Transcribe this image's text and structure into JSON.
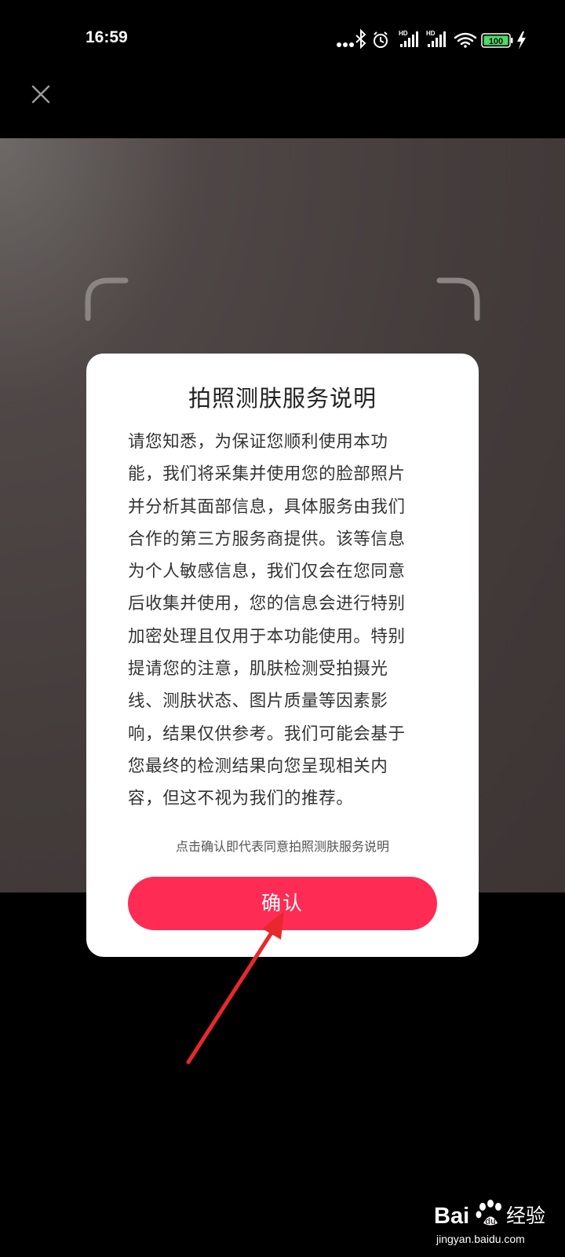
{
  "status_bar": {
    "time": "16:59",
    "battery": "100",
    "icons": [
      "more-dots-icon",
      "bluetooth-icon",
      "alarm-icon",
      "hd-signal-icon",
      "hd-signal-icon",
      "wifi-icon",
      "battery-icon",
      "charging-icon"
    ]
  },
  "close_button": {
    "icon": "close-icon"
  },
  "dialog": {
    "title": "拍照测肤服务说明",
    "body_lines": [
      "请您知悉，为保证您顺利使用本功",
      "能，我们将采集并使用您的脸部照片",
      "并分析其面部信息，具体服务由我们",
      "合作的第三方服务商提供。该等信息",
      "为个人敏感信息，我们仅会在您同意",
      "后收集并使用，您的信息会进行特别",
      "加密处理且仅用于本功能使用。特别",
      "提请您的注意，肌肤检测受拍摄光",
      "线、测肤状态、图片质量等因素影",
      "响，结果仅供参考。我们可能会基于",
      "您最终的检测结果向您呈现相关内",
      "容，但这不视为我们的推荐。"
    ],
    "note": "点击确认即代表同意拍照测肤服务说明",
    "confirm_label": "确认"
  },
  "watermark": {
    "brand": "Bai",
    "brand_suffix": "经验",
    "url": "jingyan.baidu.com"
  },
  "colors": {
    "accent": "#fe2c55",
    "annotation_arrow": "#e8282b",
    "battery_green": "#4cd964"
  }
}
